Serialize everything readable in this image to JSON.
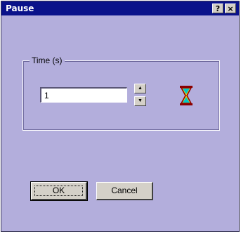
{
  "window": {
    "title": "Pause",
    "help_label": "?",
    "close_label": "×"
  },
  "group": {
    "label": "Time (s)"
  },
  "time_input": {
    "value": "1"
  },
  "spinner": {
    "up_label": "▲",
    "down_label": "▼"
  },
  "buttons": {
    "ok": "OK",
    "cancel": "Cancel"
  },
  "icons": {
    "hourglass": "hourglass-icon"
  },
  "colors": {
    "titlebar": "#0a128a",
    "background": "#b3aedc",
    "hourglass_frame": "#8b0000",
    "hourglass_sand": "#00c8c8"
  }
}
